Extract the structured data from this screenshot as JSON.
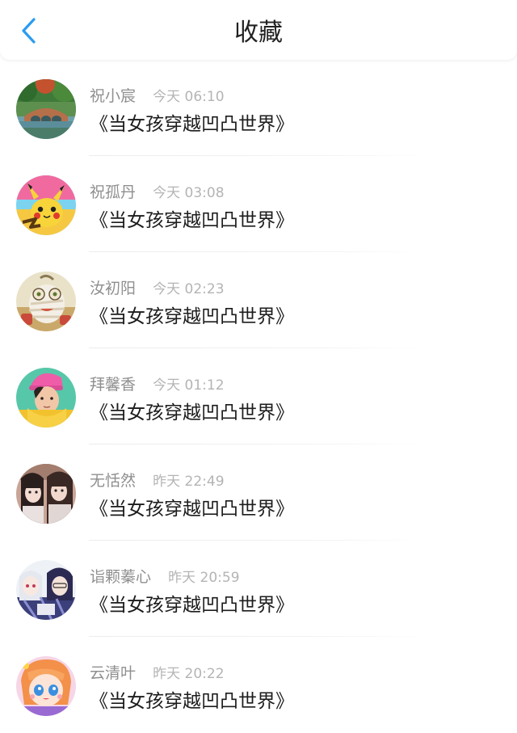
{
  "header": {
    "title": "收藏",
    "back_icon": "chevron-left-icon",
    "accent_color": "#2b9cf0"
  },
  "items": [
    {
      "name": "祝小宸",
      "time": "今天 06:10",
      "title": "《当女孩穿越凹凸世界》",
      "avatar": "landscape-bridge"
    },
    {
      "name": "祝孤丹",
      "time": "今天 03:08",
      "title": "《当女孩穿越凹凸世界》",
      "avatar": "pikachu"
    },
    {
      "name": "汝初阳",
      "time": "今天 02:23",
      "title": "《当女孩穿越凹凸世界》",
      "avatar": "bandaged-cartoon"
    },
    {
      "name": "拜馨香",
      "time": "今天 01:12",
      "title": "《当女孩穿越凹凸世界》",
      "avatar": "boy-pink-hat"
    },
    {
      "name": "无恬然",
      "time": "昨天 22:49",
      "title": "《当女孩穿越凹凸世界》",
      "avatar": "two-girls-photo"
    },
    {
      "name": "诣颗蓁心",
      "time": "昨天 20:59",
      "title": "《当女孩穿越凹凸世界》",
      "avatar": "anime-duo"
    },
    {
      "name": "云清叶",
      "time": "昨天 20:22",
      "title": "《当女孩穿越凹凸世界》",
      "avatar": "anime-girl-orange-hair"
    }
  ]
}
